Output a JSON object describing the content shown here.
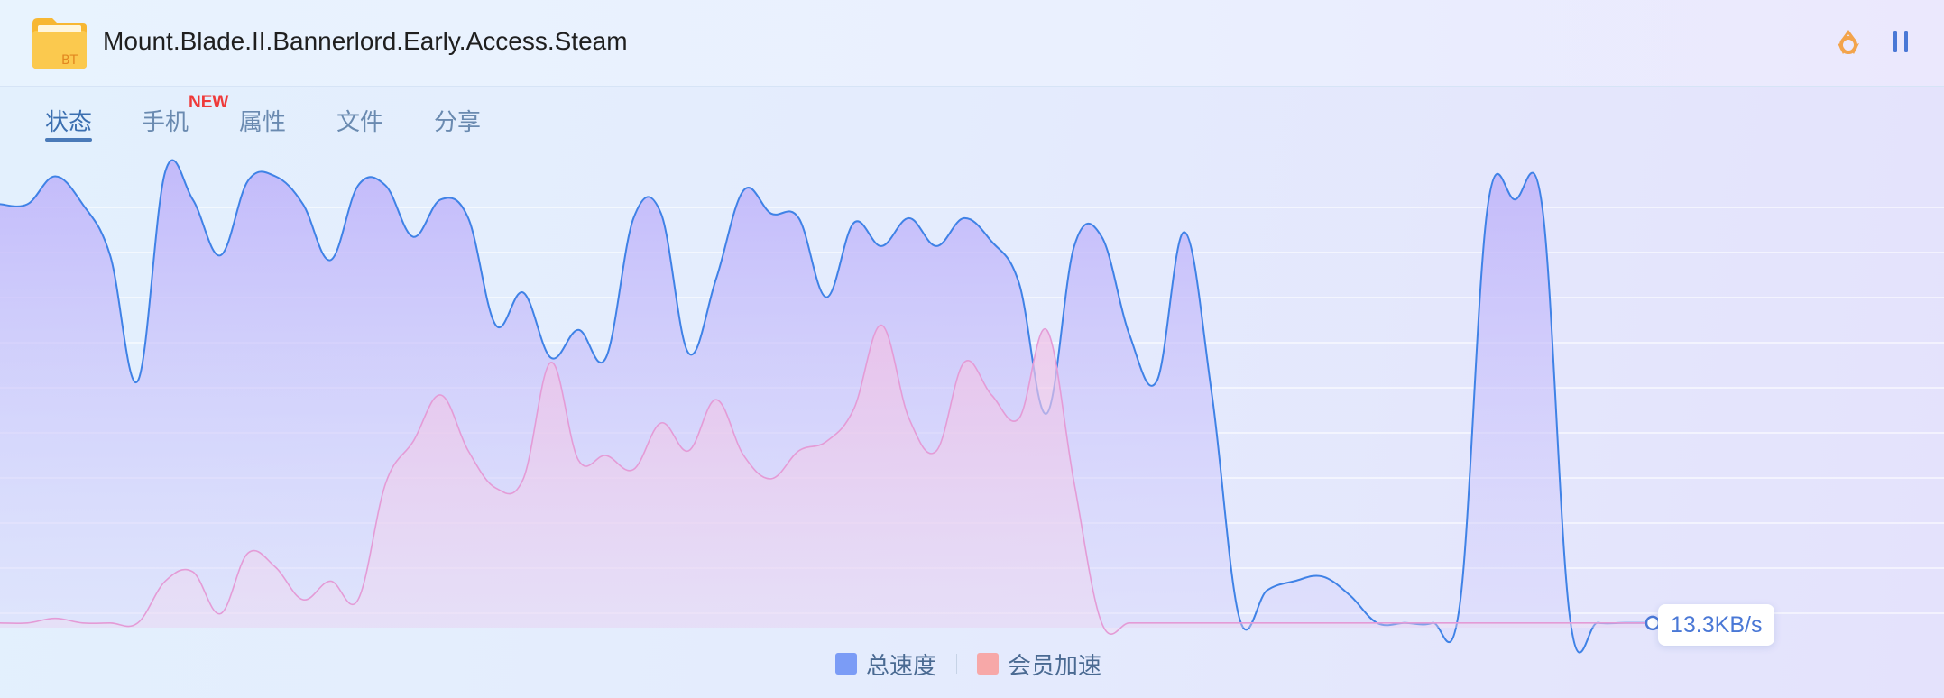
{
  "window": {
    "title": "Mount.Blade.II.Bannerlord.Early.Access.Steam",
    "file_icon": "folder-bt-icon",
    "file_icon_label": "BT",
    "actions": [
      {
        "icon": "recycle-icon",
        "color": "#f3a44b"
      },
      {
        "icon": "pause-icon",
        "color": "#4a78d6"
      }
    ]
  },
  "tabs": [
    {
      "label": "状态",
      "active": true
    },
    {
      "label": "手机",
      "badge": "NEW"
    },
    {
      "label": "属性"
    },
    {
      "label": "文件"
    },
    {
      "label": "分享"
    }
  ],
  "legend": {
    "total_label": "总速度",
    "member_label": "会员加速"
  },
  "current_speed": "13.3KB/s",
  "colors": {
    "total_line": "#3f82e6",
    "total_fill": "#c2b6fb",
    "member_line": "#e49bd6",
    "member_fill": "#f1c6e8",
    "legend_total": "#7b9cf6",
    "legend_member": "#f7a8a8",
    "badge_new": "#ef3a3a"
  },
  "chart_data": {
    "type": "area",
    "title": "",
    "xlabel": "",
    "ylabel": "",
    "x_count": 61,
    "ylim": [
      0,
      100
    ],
    "grid": true,
    "series": [
      {
        "name": "总速度",
        "values": [
          91,
          91,
          97,
          91,
          80,
          53,
          98,
          92,
          80,
          96,
          97,
          91,
          79,
          95,
          95,
          84,
          92,
          88,
          65,
          72,
          58,
          64,
          58,
          88,
          89,
          59,
          75,
          94,
          89,
          88,
          71,
          87,
          82,
          88,
          82,
          88,
          83,
          74,
          46,
          82,
          84,
          63,
          53,
          85,
          50,
          2,
          8,
          10,
          11,
          7,
          1,
          1,
          1,
          5,
          90,
          92,
          90,
          2,
          1,
          1,
          1
        ],
        "style": "smooth area"
      },
      {
        "name": "会员加速",
        "values": [
          1,
          1,
          2,
          1,
          1,
          1,
          10,
          12,
          3,
          16,
          13,
          6,
          10,
          6,
          31,
          40,
          50,
          38,
          30,
          32,
          57,
          36,
          37,
          34,
          44,
          38,
          49,
          37,
          32,
          38,
          40,
          47,
          65,
          45,
          38,
          57,
          50,
          45,
          64,
          31,
          1,
          1,
          1,
          1,
          1,
          1,
          1,
          1,
          1,
          1,
          1,
          1,
          1,
          1,
          1,
          1,
          1,
          1,
          1,
          1,
          1
        ],
        "style": "smooth area"
      }
    ]
  }
}
